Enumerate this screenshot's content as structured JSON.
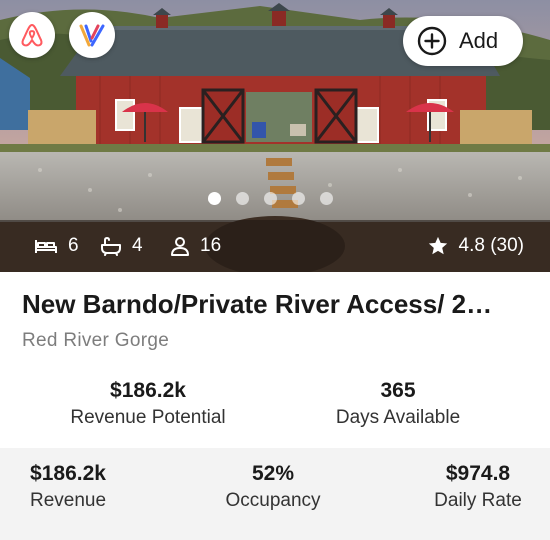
{
  "hero": {
    "badges": [
      {
        "name": "airbnb",
        "icon": "airbnb-logo-icon",
        "color": "#FF5A5F"
      },
      {
        "name": "vrbo",
        "icon": "vrbo-logo-icon",
        "color": "#3D67FF"
      }
    ],
    "add_button": {
      "icon": "plus-circle-icon",
      "label": "Add"
    },
    "carousel": {
      "count": 5,
      "active_index": 0
    },
    "stats": {
      "bedrooms": {
        "icon": "bed-icon",
        "value": "6"
      },
      "bathrooms": {
        "icon": "bathtub-icon",
        "value": "4"
      },
      "guests": {
        "icon": "person-icon",
        "value": "16"
      },
      "rating": {
        "icon": "star-icon",
        "value": "4.8 (30)"
      }
    }
  },
  "listing": {
    "title": "New Barndo/Private River Access/ 2…",
    "location": "Red River Gorge"
  },
  "metrics": {
    "revenue_potential": {
      "value": "$186.2k",
      "label": "Revenue Potential"
    },
    "days_available": {
      "value": "365",
      "label": "Days Available"
    }
  },
  "footer": {
    "revenue": {
      "value": "$186.2k",
      "label": "Revenue"
    },
    "occupancy": {
      "value": "52%",
      "label": "Occupancy"
    },
    "daily_rate": {
      "value": "$974.8",
      "label": "Daily Rate"
    }
  },
  "colors": {
    "barn_red": "#A3322A",
    "roof": "#4E5A60",
    "umbrella": "#D9334A"
  }
}
